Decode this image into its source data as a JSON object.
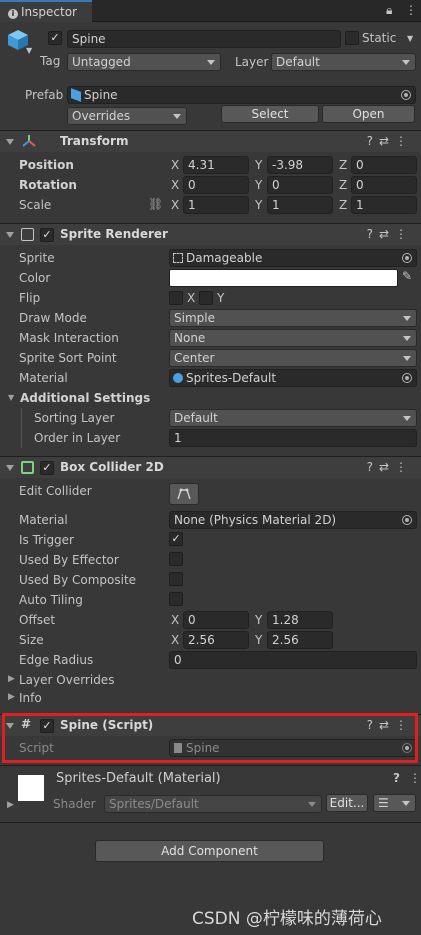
{
  "tab": {
    "title": "Inspector",
    "lock_icon": "lock-icon",
    "menu_icon": "kebab-icon"
  },
  "object": {
    "name": "Spine",
    "static_label": "Static",
    "tag_label": "Tag",
    "tag_value": "Untagged",
    "layer_label": "Layer",
    "layer_value": "Default",
    "prefab_label": "Prefab",
    "prefab_value": "Spine",
    "overrides": "Overrides",
    "select": "Select",
    "open": "Open"
  },
  "transform": {
    "title": "Transform",
    "position": {
      "label": "Position",
      "x": "4.31",
      "y": "-3.98",
      "z": "0"
    },
    "rotation": {
      "label": "Rotation",
      "x": "0",
      "y": "0",
      "z": "0"
    },
    "scale": {
      "label": "Scale",
      "x": "1",
      "y": "1",
      "z": "1"
    },
    "x": "X",
    "y": "Y",
    "z": "Z"
  },
  "sprite_renderer": {
    "title": "Sprite Renderer",
    "sprite_label": "Sprite",
    "sprite_value": "Damageable",
    "color_label": "Color",
    "color_value": "#ffffff",
    "flip_label": "Flip",
    "flip_x": "X",
    "flip_y": "Y",
    "draw_mode_label": "Draw Mode",
    "draw_mode_value": "Simple",
    "mask_label": "Mask Interaction",
    "mask_value": "None",
    "sort_point_label": "Sprite Sort Point",
    "sort_point_value": "Center",
    "material_label": "Material",
    "material_value": "Sprites-Default",
    "additional_label": "Additional Settings",
    "sorting_layer_label": "Sorting Layer",
    "sorting_layer_value": "Default",
    "order_label": "Order in Layer",
    "order_value": "1"
  },
  "box_collider": {
    "title": "Box Collider 2D",
    "edit_label": "Edit Collider",
    "material_label": "Material",
    "material_value": "None (Physics Material 2D)",
    "trigger_label": "Is Trigger",
    "trigger_checked": true,
    "effector_label": "Used By Effector",
    "composite_label": "Used By Composite",
    "tiling_label": "Auto Tiling",
    "offset_label": "Offset",
    "offset_x": "0",
    "offset_y": "1.28",
    "size_label": "Size",
    "size_x": "2.56",
    "size_y": "2.56",
    "edge_label": "Edge Radius",
    "edge_value": "0",
    "layer_overrides": "Layer Overrides",
    "info": "Info"
  },
  "spine_script": {
    "title": "Spine (Script)",
    "script_label": "Script",
    "script_value": "Spine"
  },
  "material": {
    "title": "Sprites-Default (Material)",
    "shader_label": "Shader",
    "shader_value": "Sprites/Default",
    "edit": "Edit..."
  },
  "add_component": "Add Component",
  "watermark": "CSDN @柠檬味的薄荷心"
}
